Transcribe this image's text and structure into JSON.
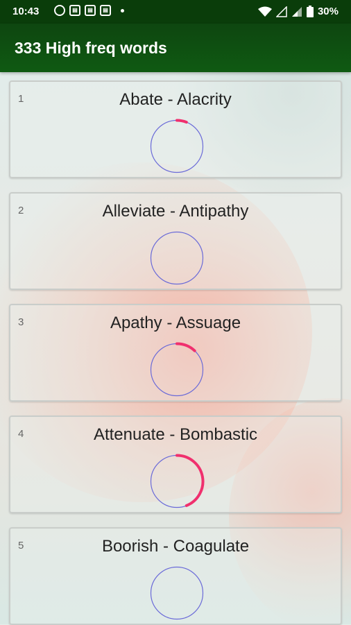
{
  "status_bar": {
    "time": "10:43",
    "battery": "30%"
  },
  "app_bar": {
    "title": "333 High freq words"
  },
  "colors": {
    "ring_outline": "#6a6ad8",
    "progress": "#f0306e",
    "app_bar": "#0f5a12"
  },
  "words": [
    {
      "index": "1",
      "title": "Abate - Alacrity",
      "progress": 0.06
    },
    {
      "index": "2",
      "title": "Alleviate - Antipathy",
      "progress": 0.0
    },
    {
      "index": "3",
      "title": "Apathy - Assuage",
      "progress": 0.12
    },
    {
      "index": "4",
      "title": "Attenuate - Bombastic",
      "progress": 0.44
    },
    {
      "index": "5",
      "title": "Boorish - Coagulate",
      "progress": 0.0
    }
  ]
}
